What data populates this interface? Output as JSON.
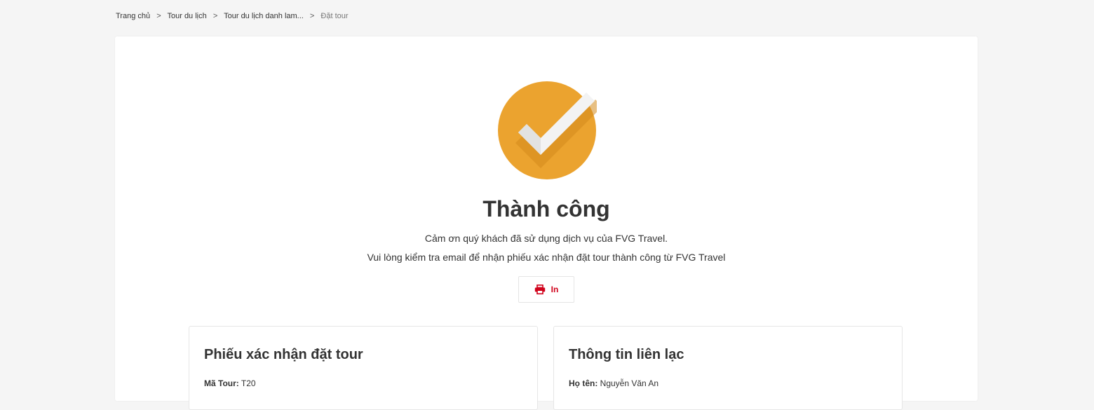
{
  "breadcrumb": {
    "items": [
      "Trang chủ",
      "Tour du lịch",
      "Tour du lịch danh lam..."
    ],
    "separator": ">",
    "current": "Đặt tour"
  },
  "success": {
    "icon": "check-circle-icon",
    "title": "Thành công",
    "line1": "Cảm ơn quý khách đã sử dụng dịch vụ của FVG Travel.",
    "line2": "Vui lòng kiểm tra email để nhận phiếu xác nhận đặt tour thành công từ FVG Travel",
    "accent_color": "#eba32f"
  },
  "print_button": {
    "icon": "printer-icon",
    "label": "In",
    "color": "#d0021b"
  },
  "booking_panel": {
    "title": "Phiếu xác nhận đặt tour",
    "field_label": "Mã Tour:",
    "field_value": "T20"
  },
  "contact_panel": {
    "title": "Thông tin liên lạc",
    "field_label": "Họ tên:",
    "field_value": "Nguyễn Văn An"
  }
}
